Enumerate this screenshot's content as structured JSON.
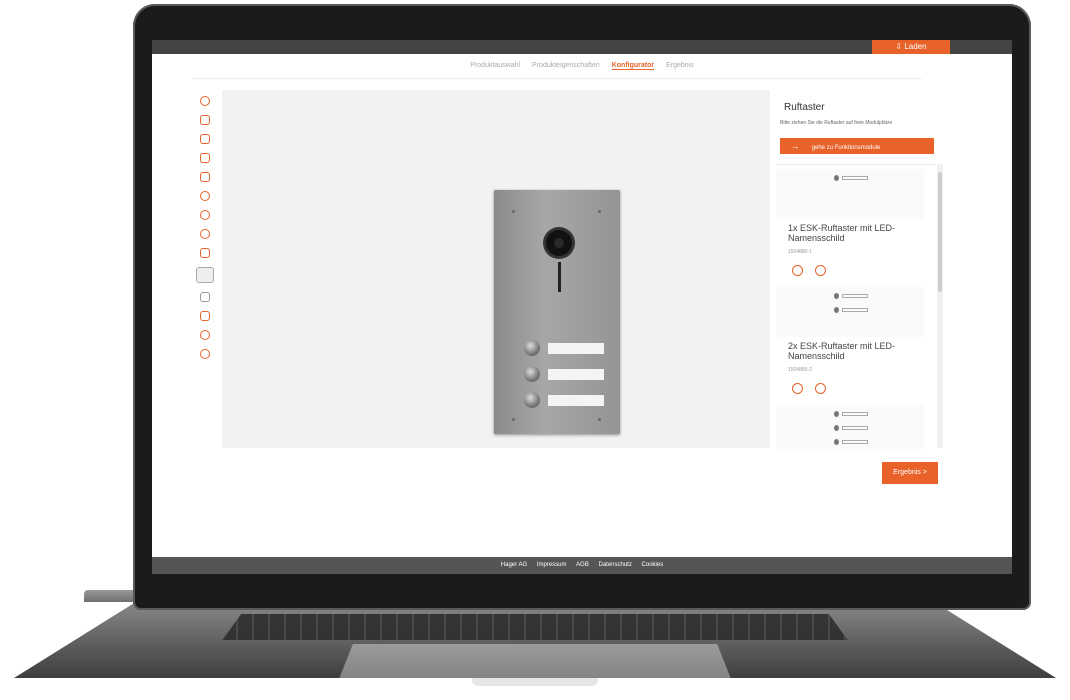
{
  "header": {
    "laden_label": "⇩ Laden"
  },
  "tabs": [
    {
      "label": "Produktauswahl"
    },
    {
      "label": "Produkteigenschaften"
    },
    {
      "label": "Konfigurator"
    },
    {
      "label": "Ergebnis"
    }
  ],
  "active_tab": "Konfigurator",
  "sidebar_icons": [
    "move-icon",
    "cube-icon",
    "camera-icon",
    "speaker-icon",
    "display-icon",
    "module-icon",
    "module-icon",
    "module-icon",
    "lock-icon",
    "grid-icon",
    "expand-icon",
    "frame-icon",
    "link-icon",
    "clock-icon"
  ],
  "side_panel": {
    "title": "Ruftaster",
    "description": "Bitte ziehen Sie die Ruftaster auf freie Modulplätze",
    "goto_button": "gehe zu Funktionsmodule",
    "goto_arrow": "→",
    "items": [
      {
        "title": "1x ESK-Ruftaster mit LED-Namensschild",
        "code": "1504880-1"
      },
      {
        "title": "2x ESK-Ruftaster mit LED-Namensschild",
        "code": "1504880-2"
      },
      {
        "title": "",
        "code": ""
      }
    ]
  },
  "ergebnis_button": "Ergebnis  >",
  "footer": {
    "links": [
      "Hager AG",
      "Impressum",
      "AGB",
      "Datenschutz",
      "Cookies"
    ]
  },
  "colors": {
    "accent": "#e8622a",
    "topbar": "#444444"
  }
}
